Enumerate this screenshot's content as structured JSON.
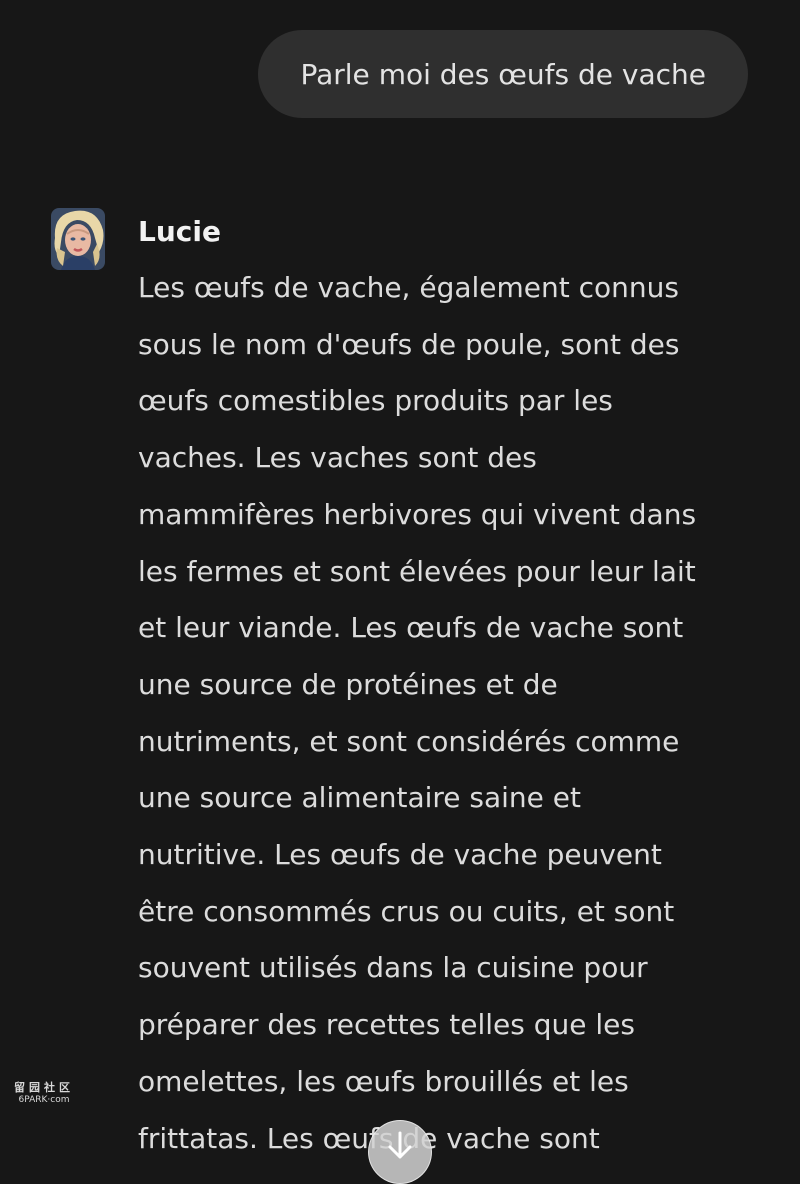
{
  "user_message": {
    "text": "Parle moi des œufs de vache"
  },
  "assistant": {
    "name": "Lucie",
    "avatar_icon": "woman-portrait-avatar",
    "lines": [
      "Les œufs de vache, également connus",
      "sous le nom d'œufs de poule, sont des",
      "œufs comestibles produits par les",
      "vaches. Les vaches sont des",
      "mammifères herbivores qui vivent dans",
      "les fermes et sont élevées pour leur lait",
      "et leur viande. Les œufs de vache sont",
      "une source de protéines et de",
      "nutriments, et sont considérés comme",
      "une source alimentaire saine et",
      "nutritive. Les œufs de vache peuvent",
      "être consommés crus ou cuits, et sont",
      "souvent utilisés dans la cuisine pour",
      "préparer des recettes telles que les",
      "omelettes, les œufs brouillés et les",
      "frittatas. Les œufs de vache sont"
    ]
  },
  "watermark": {
    "line1": "留园社区",
    "line2": "6PARK·com"
  },
  "scroll_button": {
    "icon": "arrow-down-icon"
  },
  "colors": {
    "background": "#171717",
    "user_bubble": "#2f2f2f",
    "text": "#dcdcdc"
  }
}
